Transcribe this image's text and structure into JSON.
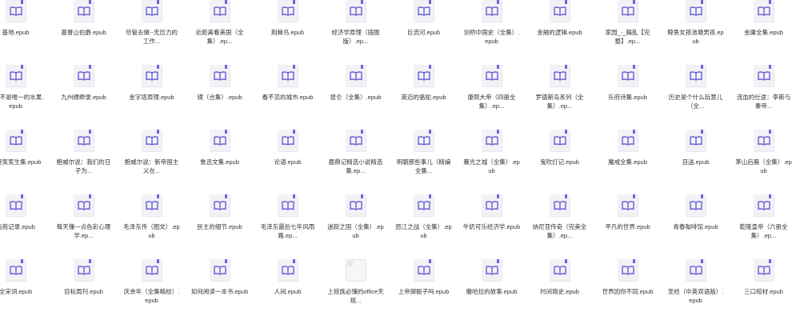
{
  "icon_color": "#7264d6",
  "tile_color": "#f1f2f6",
  "files": [
    {
      "name": "基地.epub",
      "icon": "book-icon"
    },
    {
      "name": "基督山伯爵.epub",
      "icon": "book-icon"
    },
    {
      "name": "尽管去做--无压力的工作...",
      "icon": "book-icon"
    },
    {
      "name": "近距离看美国（全集）.ep...",
      "icon": "book-icon"
    },
    {
      "name": "荆棘鸟.epub",
      "icon": "book-icon"
    },
    {
      "name": "经济学原理（插图版）.ep...",
      "icon": "book-icon"
    },
    {
      "name": "巨流河.epub",
      "icon": "book-icon"
    },
    {
      "name": "剑桥中国史（全集）.epub",
      "icon": "book-icon"
    },
    {
      "name": "金融的逻辑.epub",
      "icon": "book-icon"
    },
    {
      "name": "家园_-_蹋乱【完整】.ep...",
      "icon": "book-icon"
    },
    {
      "name": "鲸鱼女孩池塘男孩.epub",
      "icon": "book-icon"
    },
    {
      "name": "金庸全集.epub",
      "icon": "book-icon"
    },
    {
      "name": "橘子不是唯一的水果.epub",
      "icon": "book-icon"
    },
    {
      "name": "九州缥缈录.epub",
      "icon": "book-icon"
    },
    {
      "name": "金字塔原理.epub",
      "icon": "book-icon"
    },
    {
      "name": "镜（合集）.epub",
      "icon": "book-icon"
    },
    {
      "name": "看不见的城市.epub",
      "icon": "book-icon"
    },
    {
      "name": "昆仑（全集）.epub",
      "icon": "book-icon"
    },
    {
      "name": "英迈的骆驼.epub",
      "icon": "book-icon"
    },
    {
      "name": "康熙大帝（四册全集）.ep...",
      "icon": "book-icon"
    },
    {
      "name": "罗德斯岛系列（全集）.ep...",
      "icon": "book-icon"
    },
    {
      "name": "乐府诗集.epub",
      "icon": "book-icon"
    },
    {
      "name": "历史是个什么玩意儿（全...",
      "icon": "book-icon"
    },
    {
      "name": "流血的仕途：李斯与秦帝...",
      "icon": "book-icon"
    },
    {
      "name": "兰陵笑笑生集.epub",
      "icon": "book-icon"
    },
    {
      "name": "鲍威尔说：我们的日子为...",
      "icon": "book-icon"
    },
    {
      "name": "鲍威尔说：新帝国主义在...",
      "icon": "book-icon"
    },
    {
      "name": "鲁迅文集.epub",
      "icon": "book-icon"
    },
    {
      "name": "论语.epub",
      "icon": "book-icon"
    },
    {
      "name": "鹿鼎记精选小说精选集.ep...",
      "icon": "book-icon"
    },
    {
      "name": "明朝那些事儿（精编全集...",
      "icon": "book-icon"
    },
    {
      "name": "暮光之城（全集）.epub",
      "icon": "book-icon"
    },
    {
      "name": "鬼吹灯记.epub",
      "icon": "book-icon"
    },
    {
      "name": "魔戒全集.epub",
      "icon": "book-icon"
    },
    {
      "name": "目送.epub",
      "icon": "book-icon"
    },
    {
      "name": "茅山后裔（全集）.epub",
      "icon": "book-icon"
    },
    {
      "name": "南苑记录.epub",
      "icon": "book-icon"
    },
    {
      "name": "每天懂一点色彩心理学.ep...",
      "icon": "book-icon"
    },
    {
      "name": "毛泽东传（图文）.epub",
      "icon": "book-icon"
    },
    {
      "name": "民主的细节.epub",
      "icon": "book-icon"
    },
    {
      "name": "毛泽东最后七年风雨路.ep...",
      "icon": "book-icon"
    },
    {
      "name": "迷踪之国（全集）.epub",
      "icon": "book-icon"
    },
    {
      "name": "怒江之战（全集）.epub",
      "icon": "book-icon"
    },
    {
      "name": "牛奶可乐经济学.epub",
      "icon": "book-icon"
    },
    {
      "name": "纳尼亚传奇（完美全集）.ep...",
      "icon": "book-icon"
    },
    {
      "name": "平凡的世界.epub",
      "icon": "book-icon"
    },
    {
      "name": "青春咖啡馆.epub",
      "icon": "book-icon"
    },
    {
      "name": "乾隆皇帝（六册全集）.ep...",
      "icon": "book-icon"
    },
    {
      "name": "全宋词.epub",
      "icon": "book-icon"
    },
    {
      "name": "目标周刊.epub",
      "icon": "book-icon"
    },
    {
      "name": "庆余年（全集精校）.epub",
      "icon": "book-icon"
    },
    {
      "name": "如何阅读一本书.epub",
      "icon": "book-icon"
    },
    {
      "name": "人间.epub",
      "icon": "book-icon"
    },
    {
      "name": "上班族必懂的office天规...",
      "icon": "blank-file-icon"
    },
    {
      "name": "上帝掷骰子吗.epub",
      "icon": "book-icon"
    },
    {
      "name": "撒哈拉的故事.epub",
      "icon": "book-icon"
    },
    {
      "name": "时间简史.epub",
      "icon": "book-icon"
    },
    {
      "name": "世界因你不同.epub",
      "icon": "book-icon"
    },
    {
      "name": "圣经（中英双语版）.epub",
      "icon": "book-icon"
    },
    {
      "name": "三口棺材.epub",
      "icon": "book-icon"
    }
  ]
}
